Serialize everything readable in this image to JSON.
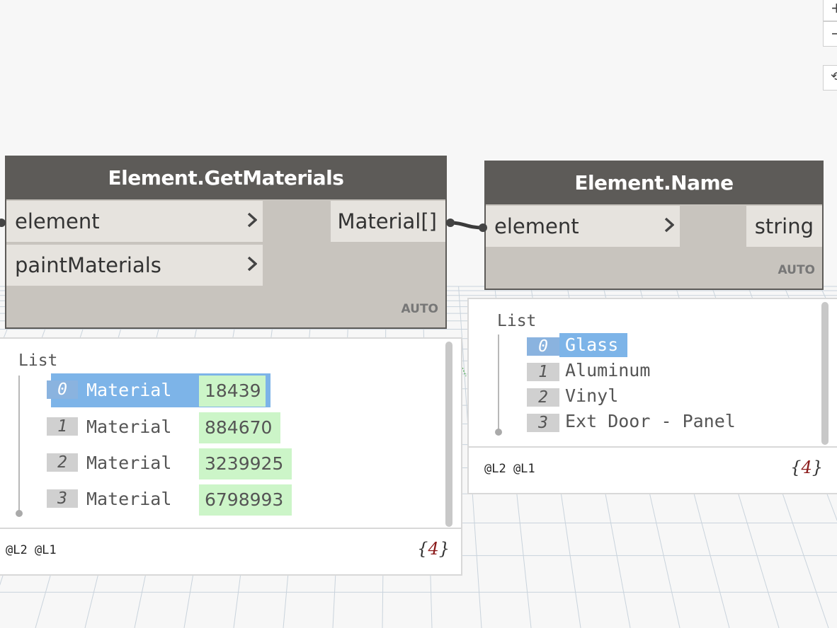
{
  "zoom_controls": {
    "zoom_in": "+",
    "zoom_out": "−",
    "fit": "⟲"
  },
  "get_materials": {
    "title": "Element.GetMaterials",
    "inputs": [
      "element",
      "paintMaterials"
    ],
    "output": "Material[]",
    "lacing": "AUTO",
    "preview": {
      "list_label": "List",
      "items": [
        {
          "index": "0",
          "text": "Material",
          "id": "18439"
        },
        {
          "index": "1",
          "text": "Material",
          "id": "884670"
        },
        {
          "index": "2",
          "text": "Material",
          "id": "3239925"
        },
        {
          "index": "3",
          "text": "Material",
          "id": "6798993"
        }
      ],
      "levels": "@L2 @L1",
      "count_open": "{",
      "count": "4",
      "count_close": "}"
    }
  },
  "element_name": {
    "title": "Element.Name",
    "inputs": [
      "element"
    ],
    "output": "string",
    "lacing": "AUTO",
    "preview": {
      "list_label": "List",
      "items": [
        {
          "index": "0",
          "text": "Glass"
        },
        {
          "index": "1",
          "text": "Aluminum"
        },
        {
          "index": "2",
          "text": "Vinyl"
        },
        {
          "index": "3",
          "text": "Ext Door - Panel"
        }
      ],
      "levels": "@L2 @L1",
      "count_open": "{",
      "count": "4",
      "count_close": "}"
    }
  },
  "colors": {
    "node_header": "#5d5b58",
    "node_body": "#c8c4be",
    "port_bg": "#e6e3de",
    "selection": "#7db4e8",
    "id_highlight": "#ccf5c8"
  }
}
